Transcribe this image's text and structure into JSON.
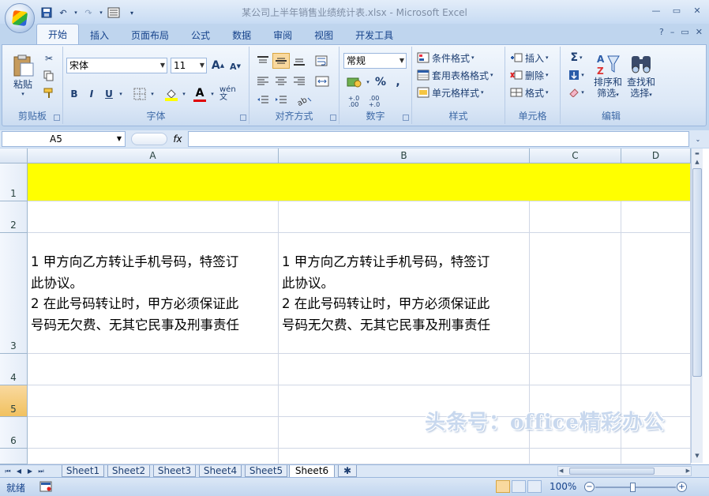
{
  "window": {
    "title": "某公司上半年销售业绩统计表.xlsx - Microsoft Excel"
  },
  "tabs": [
    {
      "label": "开始",
      "active": true
    },
    {
      "label": "插入"
    },
    {
      "label": "页面布局"
    },
    {
      "label": "公式"
    },
    {
      "label": "数据"
    },
    {
      "label": "审阅"
    },
    {
      "label": "视图"
    },
    {
      "label": "开发工具"
    }
  ],
  "ribbon": {
    "clipboard": {
      "label": "剪贴板",
      "paste": "粘贴"
    },
    "font": {
      "label": "字体",
      "name": "宋体",
      "size": "11",
      "bold": "B",
      "italic": "I",
      "underline": "U",
      "grow": "A",
      "shrink": "A",
      "fontcolor": "A",
      "wen": "wén 文"
    },
    "alignment": {
      "label": "对齐方式"
    },
    "number": {
      "label": "数字",
      "format": "常规",
      "percent": "%",
      "comma": ",",
      "inc": "+.0 .00",
      "dec": ".00 +.0"
    },
    "styles": {
      "label": "样式",
      "conditional": "条件格式",
      "table": "套用表格格式",
      "cell": "单元格样式"
    },
    "cells": {
      "label": "单元格",
      "insert": "插入",
      "delete": "删除",
      "format": "格式"
    },
    "editing": {
      "label": "编辑",
      "sigma": "Σ",
      "sort": "排序和",
      "sort2": "筛选",
      "find": "查找和",
      "find2": "选择"
    }
  },
  "formula_bar": {
    "namebox": "A5",
    "fx": "fx",
    "value": ""
  },
  "grid": {
    "columns": [
      "A",
      "B",
      "C",
      "D"
    ],
    "rows": [
      "1",
      "2",
      "3",
      "4",
      "5",
      "6"
    ],
    "highlight_color": "#ffff00",
    "cells": {
      "A3": [
        "1 甲方向乙方转让手机号码，特签订",
        "此协议。",
        "2 在此号码转让时，甲方必须保证此",
        "号码无欠费、无其它民事及刑事责任"
      ],
      "B3": [
        "1 甲方向乙方转让手机号码，特签订",
        "此协议。",
        "2 在此号码转让时，甲方必须保证此",
        "号码无欠费、无其它民事及刑事责任"
      ]
    }
  },
  "watermark": "头条号：office精彩办公",
  "sheets": [
    {
      "label": "Sheet1"
    },
    {
      "label": "Sheet2"
    },
    {
      "label": "Sheet3"
    },
    {
      "label": "Sheet4"
    },
    {
      "label": "Sheet5"
    },
    {
      "label": "Sheet6",
      "active": true
    }
  ],
  "status": {
    "mode": "就绪",
    "zoom": "100%"
  }
}
